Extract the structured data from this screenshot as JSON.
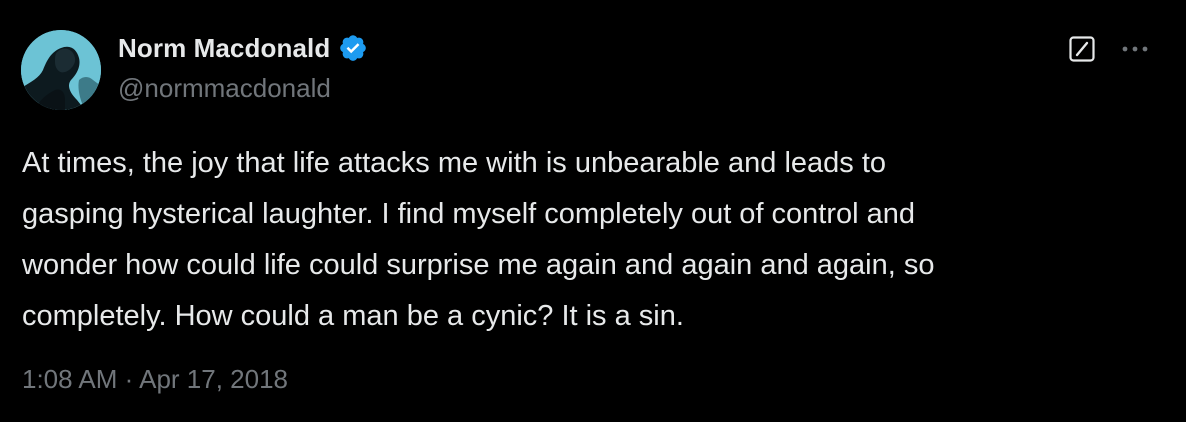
{
  "tweet": {
    "author": {
      "display_name": "Norm Macdonald",
      "handle": "@normmacdonald",
      "verified": true,
      "avatar_icon": "profile-photo"
    },
    "text": "At times, the joy that life attacks me with is unbearable and leads to\ngasping hysterical laughter. I find myself completely out of control and\nwonder how could life could surprise me again and again and again, so\ncompletely. How could a man be a cynic? It is a sin.",
    "time": "1:08 AM",
    "separator": "·",
    "date": "Apr 17, 2018"
  },
  "icons": {
    "verified": "verified-badge-icon",
    "grok": "grok-icon",
    "more": "more-options-icon"
  },
  "colors": {
    "background": "#000000",
    "text_primary": "#e7e9ea",
    "text_secondary": "#71767b",
    "verified_blue": "#1d9bf0"
  }
}
